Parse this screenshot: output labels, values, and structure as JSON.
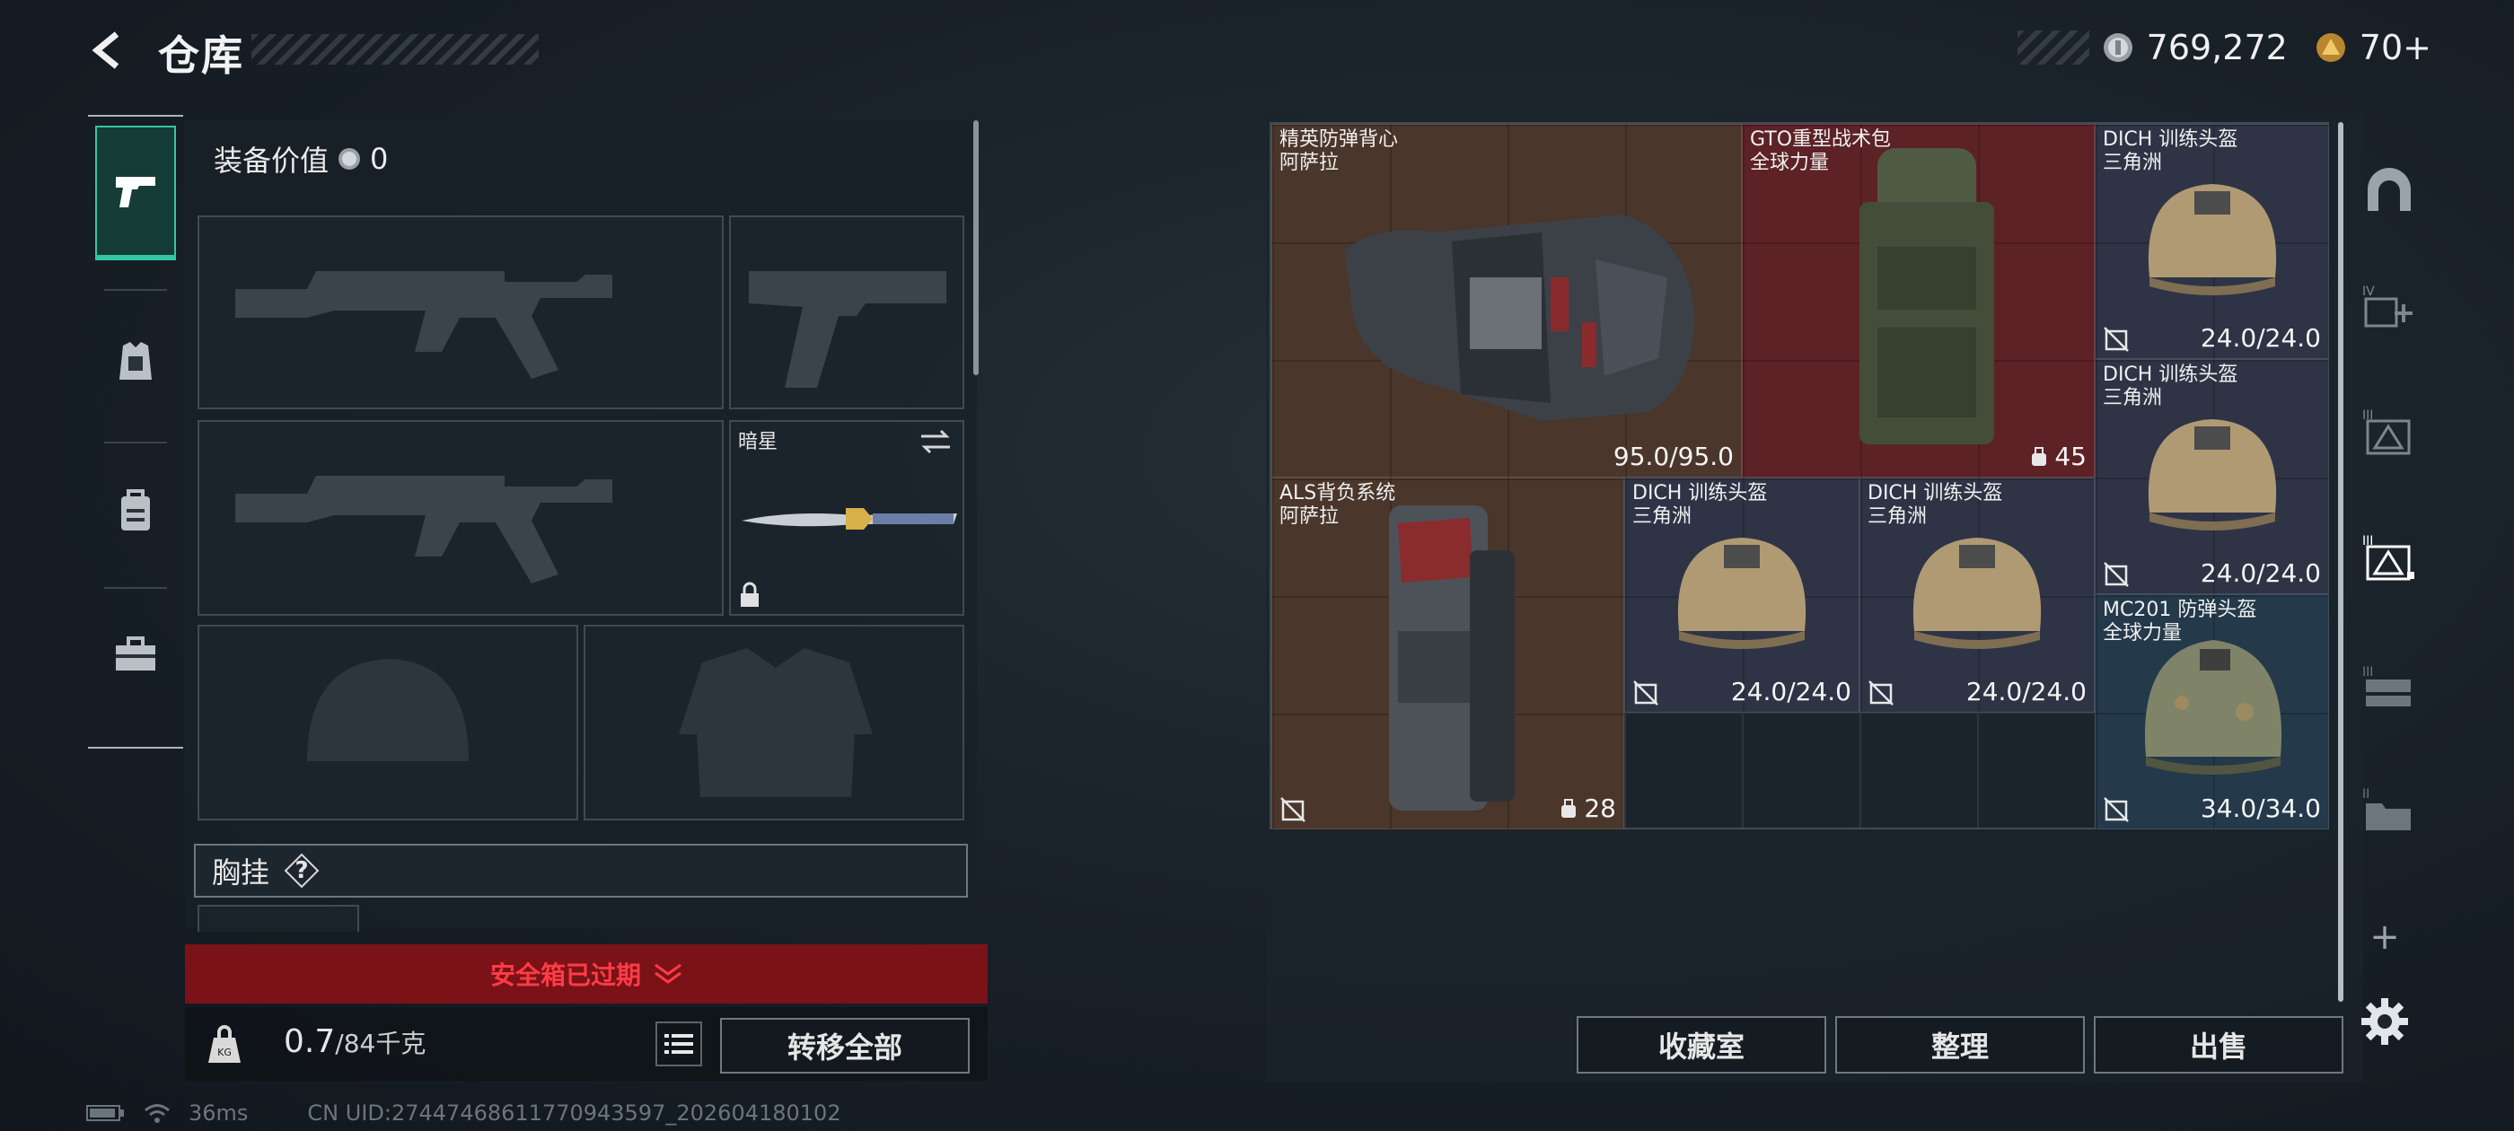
{
  "header": {
    "title": "仓库"
  },
  "currency": {
    "coins": "769,272",
    "tickets": "70+"
  },
  "equipment": {
    "value_label": "装备价值",
    "value": "0",
    "knife_slot_label": "暗星",
    "chest_rig_label": "胸挂",
    "help": "?"
  },
  "safebox": {
    "expired_text": "安全箱已过期"
  },
  "weight": {
    "current": "0.7",
    "max": "/84千克"
  },
  "transfer_all_label": "转移全部",
  "status": {
    "ping": "36ms",
    "uid": "CN UID:27447468611770943597_202604180102"
  },
  "stash": {
    "items": [
      {
        "name": "精英防弹背心",
        "brand": "阿萨拉",
        "value": "95.0/95.0"
      },
      {
        "name": "GTO重型战术包",
        "brand": "全球力量",
        "value": "45"
      },
      {
        "name": "DICH 训练头盔",
        "brand": "三角洲",
        "value": "24.0/24.0"
      },
      {
        "name": "DICH 训练头盔",
        "brand": "三角洲",
        "value": "24.0/24.0"
      },
      {
        "name": "ALS背负系统",
        "brand": "阿萨拉",
        "value": "28"
      },
      {
        "name": "DICH 训练头盔",
        "brand": "三角洲",
        "value": "24.0/24.0"
      },
      {
        "name": "DICH 训练头盔",
        "brand": "三角洲",
        "value": "24.0/24.0"
      },
      {
        "name": "MC201 防弹头盔",
        "brand": "全球力量",
        "value": "34.0/34.0"
      }
    ]
  },
  "buttons": {
    "collection": "收藏室",
    "sort": "整理",
    "sell": "出售"
  },
  "colors": {
    "accent": "#32c6a4",
    "alert": "#ff3b45",
    "alert_bg": "#7a1218"
  }
}
